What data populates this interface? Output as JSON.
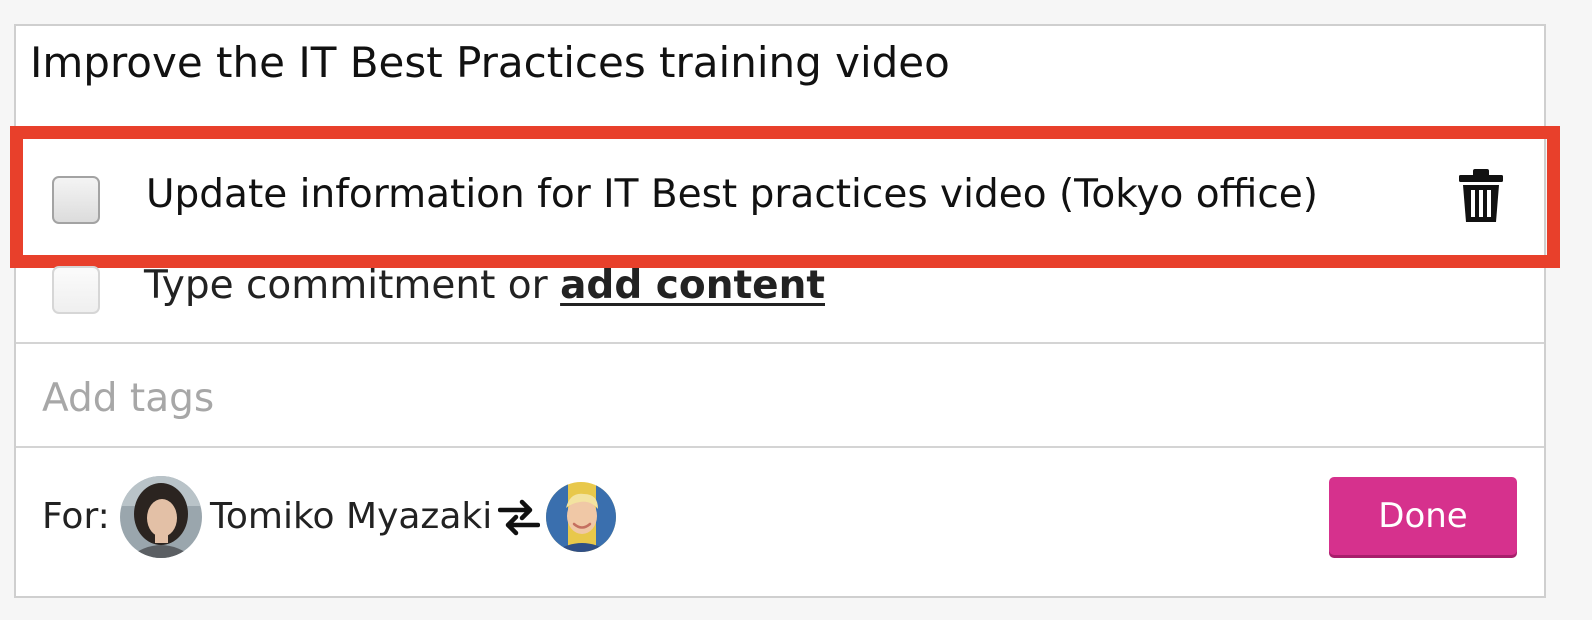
{
  "card": {
    "title": "Improve the IT Best Practices training video"
  },
  "commitment": {
    "text": "Update information for IT Best practices video (Tokyo office)",
    "checked": false,
    "delete_icon": "trash-icon"
  },
  "new_commitment": {
    "prefix": "Type commitment or ",
    "link_label": "add content"
  },
  "tags": {
    "placeholder": "Add tags"
  },
  "footer": {
    "for_label": "For:",
    "owner_name": "Tomiko Myazaki",
    "swap_icon": "swap-arrows-icon",
    "done_label": "Done"
  },
  "colors": {
    "highlight": "#e8402b",
    "done_button": "#d6318d"
  }
}
